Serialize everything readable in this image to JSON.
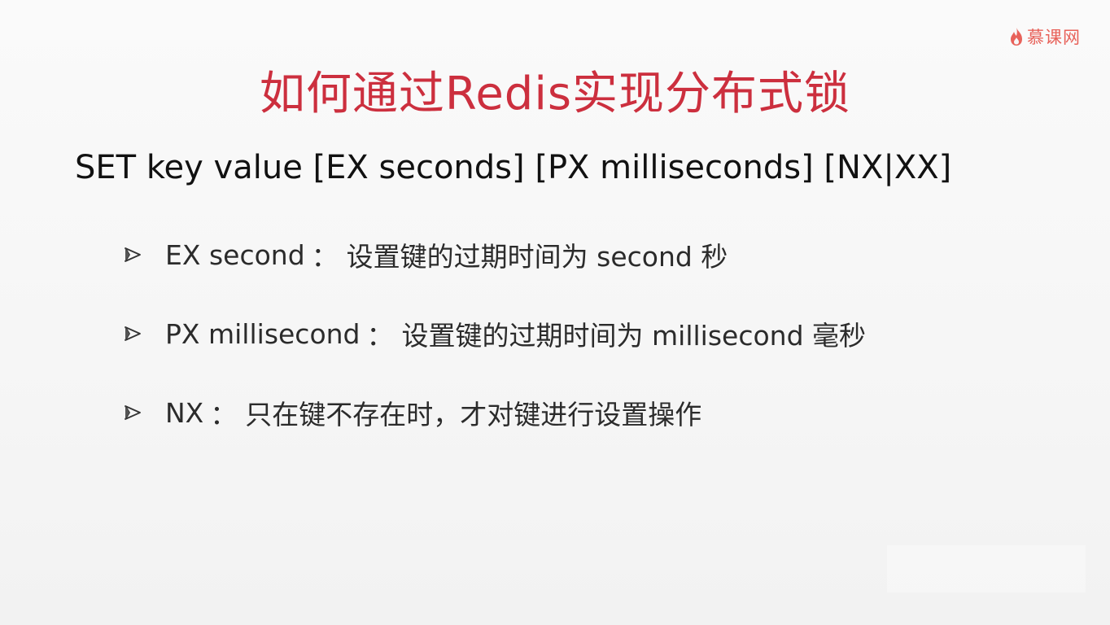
{
  "brand": {
    "name": "慕课网",
    "icon": "flame-logo-icon",
    "color": "#e8625a"
  },
  "slide": {
    "title": "如何通过Redis实现分布式锁",
    "title_color": "#cc2f3e",
    "command": "SET key value [EX seconds] [PX milliseconds] [NX|XX]",
    "bullet_icon": "arrow-bullet-icon",
    "options": [
      {
        "key": "EX second",
        "sep": "：",
        "desc": "设置键的过期时间为 second 秒"
      },
      {
        "key": "PX millisecond",
        "sep": "：",
        "desc": "设置键的过期时间为 millisecond 毫秒"
      },
      {
        "key": "NX",
        "sep": "：",
        "desc": "只在键不存在时，才对键进行设置操作"
      }
    ]
  }
}
